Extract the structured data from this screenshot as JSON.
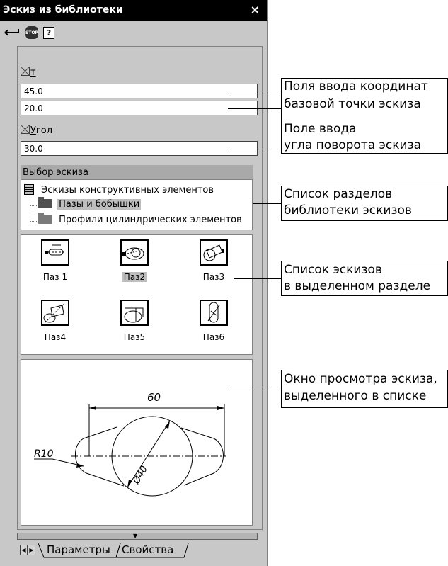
{
  "window": {
    "title": "Эскиз из библиотеки",
    "close_label": "×"
  },
  "toolbar": {
    "stop_label": "STOP",
    "help_label": "?"
  },
  "fields": {
    "t_label": "т",
    "x_value": "45.0",
    "y_value": "20.0",
    "angle_label_first": "У",
    "angle_label_rest": "гол",
    "angle_value": "30.0"
  },
  "sketch_select": {
    "title": "Выбор эскиза",
    "tree": {
      "root": "Эскизы конструктивных элементов",
      "items": [
        "Пазы и бобышки",
        "Профили цилиндрических элементов"
      ],
      "selected_index": 0
    }
  },
  "thumbnails": [
    {
      "label": "Паз 1"
    },
    {
      "label": "Паз2",
      "selected": true
    },
    {
      "label": "Паз3"
    },
    {
      "label": "Паз4"
    },
    {
      "label": "Паз5"
    },
    {
      "label": "Паз6"
    }
  ],
  "preview": {
    "dim_length": "60",
    "dim_radius": "R10",
    "dim_diameter": "Ø40"
  },
  "tabs": [
    {
      "label": "Параметры",
      "active": true
    },
    {
      "label": "Свойства",
      "active": false
    }
  ],
  "annotations": {
    "coords": [
      "Поля ввода координат",
      "базовой точки  эскиза"
    ],
    "angle": [
      "Поле ввода",
      "угла поворота эскиза"
    ],
    "sections": [
      "Список разделов",
      "библиотеки эскизов"
    ],
    "sketches": [
      "Список эскизов",
      "в выделенном разделе"
    ],
    "preview": [
      "Окно просмотра эскиза,",
      "выделенного в списке"
    ]
  }
}
